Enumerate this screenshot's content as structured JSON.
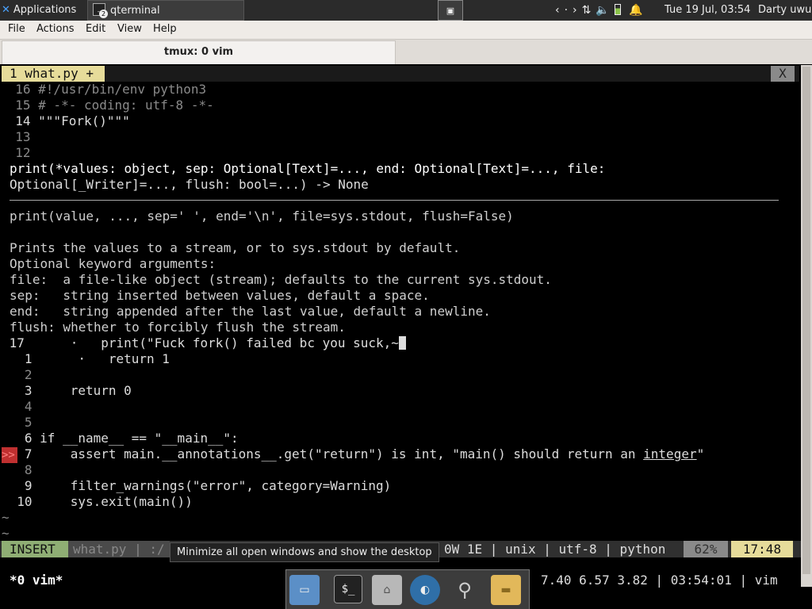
{
  "panel": {
    "applications_label": "Applications",
    "task_title": "qterminal",
    "task_badge": "2",
    "clock": "Tue 19 Jul, 03:54",
    "user": "Darty uwu"
  },
  "menubar": {
    "items": [
      "File",
      "Actions",
      "Edit",
      "View",
      "Help"
    ]
  },
  "tab": {
    "title": "tmux: 0 vim"
  },
  "vim": {
    "buffer_label": "1 what.py +",
    "close_label": "X",
    "lines": {
      "l16": "  16 #!/usr/bin/env python3",
      "l15": "  15 # -*- coding: utf-8 -*-",
      "l14": "  14 \"\"\"Fork()\"\"\"",
      "l13": "  13",
      "l12": "  12"
    },
    "sig1": "print(*values: object, sep: Optional[Text]=..., end: Optional[Text]=..., file:",
    "sig2": "Optional[_Writer]=..., flush: bool=...) -> None",
    "doc": [
      "print(value, ..., sep=' ', end='\\n', file=sys.stdout, flush=False)",
      "",
      "Prints the values to a stream, or to sys.stdout by default.",
      "Optional keyword arguments:",
      "file:  a file-like object (stream); defaults to the current sys.stdout.",
      "sep:   string inserted between values, default a space.",
      "end:   string appended after the last value, default a newline.",
      "flush: whether to forcibly flush the stream."
    ],
    "code_after": {
      "c17": " 17      ·   print(\"Fuck fork() failed bc you suck,~",
      "c1": "   1      ·   return 1",
      "c2": "   2",
      "c3": "   3     return 0",
      "c4": "   4",
      "c5": "   5",
      "c6": "   6 if __name__ == \"__main__\":",
      "c7a": "   7     assert main.__annotations__.get(\"return\") is int, \"main() should return an ",
      "c7b": "integer",
      "c7c": "\"",
      "c8": "   8",
      "c9": "   9     filter_warnings(\"error\", category=Warning)",
      "c10": "  10     sys.exit(main())"
    },
    "sign_marker": ">>",
    "tilde": "~",
    "status": {
      "mode": "INSERT",
      "filename": "what.py | :/",
      "right": "0W 1E | unix | utf-8 | python",
      "percent": "62%",
      "position": "17:48"
    }
  },
  "tmux": {
    "window": "*0 vim*",
    "right": "7.40 6.57 3.82 | 03:54:01 | vim"
  },
  "tooltip": "Minimize all open windows and show the desktop",
  "dock": [
    "show-desktop",
    "terminal",
    "home-folder",
    "web-browser",
    "search",
    "files"
  ]
}
